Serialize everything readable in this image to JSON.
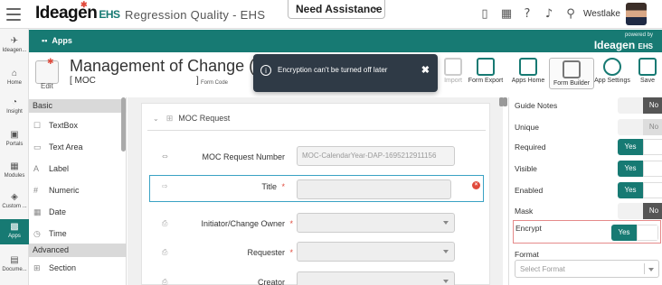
{
  "topbar": {
    "brand": "Ideagen",
    "brand_suffix": "EHS",
    "app_title": "Regression Quality - EHS",
    "assist_label": "Need Assistance",
    "user_name": "Westlake",
    "icons": [
      "hamburger-icon",
      "mobile-icon",
      "calendar-icon",
      "help-icon",
      "bell-icon",
      "location-icon",
      "avatar"
    ]
  },
  "sidenav": {
    "items": [
      {
        "label": "Ideagen...",
        "icon": "pin-icon"
      },
      {
        "label": "Home",
        "icon": "home-icon"
      },
      {
        "label": "Insight",
        "icon": "insight-icon"
      },
      {
        "label": "Portals",
        "icon": "portal-icon"
      },
      {
        "label": "Modules",
        "icon": "grid-icon"
      },
      {
        "label": "Custom ...",
        "icon": "layers-icon"
      },
      {
        "label": "Apps",
        "icon": "apps-icon"
      },
      {
        "label": "Docume...",
        "icon": "document-icon"
      }
    ],
    "active": "Apps"
  },
  "apps_bar": {
    "label": "Apps",
    "powered_by": "powered by",
    "powered_brand": "Ideagen",
    "powered_suffix": "EHS"
  },
  "header": {
    "title": "Management of Change (MOC",
    "code_bracket": "[ MOC",
    "code_close": "]",
    "form_code_label": "Form Code",
    "edit_label": "Edit",
    "buttons": [
      {
        "label": "Import",
        "icon": "import-icon"
      },
      {
        "label": "Form Export",
        "icon": "form-export-icon"
      },
      {
        "label": "Apps Home",
        "icon": "apps-home-icon"
      },
      {
        "label": "Form Builder",
        "icon": "form-builder-icon"
      },
      {
        "label": "App Settings",
        "icon": "gear-icon"
      },
      {
        "label": "Save",
        "icon": "save-icon"
      }
    ]
  },
  "toast": {
    "message": "Encryption can't be turned off later"
  },
  "palette": {
    "basic_header": "Basic",
    "basic_items": [
      {
        "label": "TextBox",
        "icon": "textbox-icon"
      },
      {
        "label": "Text Area",
        "icon": "textarea-icon"
      },
      {
        "label": "Label",
        "icon": "label-icon"
      },
      {
        "label": "Numeric",
        "icon": "hash-icon"
      },
      {
        "label": "Date",
        "icon": "calendar-icon"
      },
      {
        "label": "Time",
        "icon": "clock-icon"
      }
    ],
    "advanced_header": "Advanced",
    "advanced_items": [
      {
        "label": "Section",
        "icon": "section-icon"
      }
    ]
  },
  "canvas": {
    "section_title": "MOC Request",
    "fields": [
      {
        "label": "MOC Request Number",
        "value": "MOC-CalendarYear-DAP-1695212911156",
        "required": false,
        "dropdown": false
      },
      {
        "label": "Title",
        "value": "",
        "required": true,
        "dropdown": false
      },
      {
        "label": "Initiator/Change Owner",
        "value": "",
        "required": true,
        "dropdown": true
      },
      {
        "label": "Requester",
        "value": "",
        "required": true,
        "dropdown": true
      },
      {
        "label": "Creator",
        "value": "",
        "required": false,
        "dropdown": true
      }
    ]
  },
  "properties": {
    "rows": [
      {
        "label": "Guide Notes",
        "state": "No"
      },
      {
        "label": "Unique",
        "state": "No"
      },
      {
        "label": "Required",
        "state": "Yes"
      },
      {
        "label": "Visible",
        "state": "Yes"
      },
      {
        "label": "Enabled",
        "state": "Yes"
      },
      {
        "label": "Mask",
        "state": "No"
      },
      {
        "label": "Encrypt",
        "state": "Yes"
      }
    ],
    "format_label": "Format",
    "format_placeholder": "Select Format"
  }
}
